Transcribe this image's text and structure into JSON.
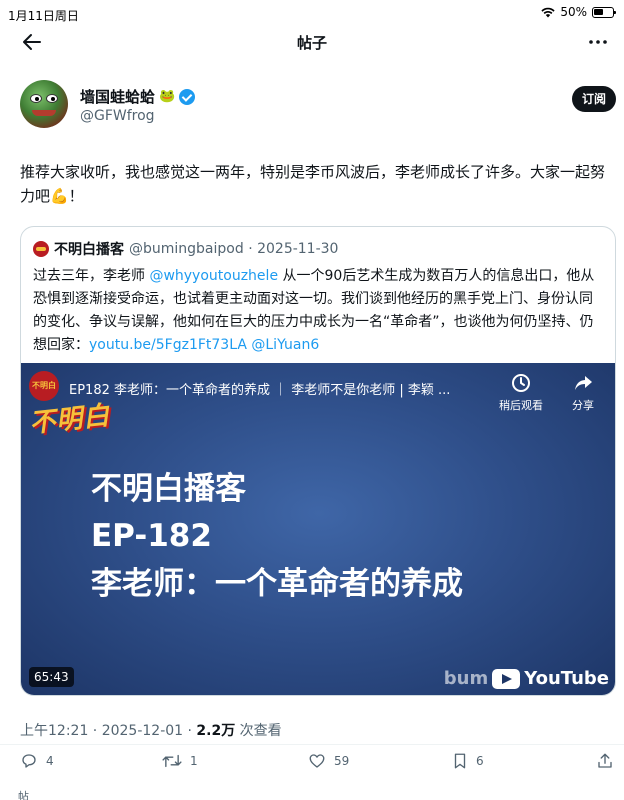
{
  "status_bar": {
    "time": "1月11日周日",
    "battery_percent": "50%"
  },
  "nav": {
    "title": "帖子",
    "icons": [
      "back-arrow-icon",
      "more-icon"
    ]
  },
  "author": {
    "display_name": "墙国蛙蛤蛤",
    "name_emoji": "🐸",
    "handle": "@GFWfrog",
    "subscribe_label": "订阅",
    "verified": true
  },
  "post": {
    "text": "推荐大家收听，我也感觉这一两年，特别是李币风波后，李老师成长了许多。大家一起努力吧💪！",
    "timestamp": "上午12:21 · 2025-12-01 · ",
    "views_count": "2.2万",
    "views_label": " 次查看"
  },
  "quoted": {
    "name": "不明白播客",
    "meta": "@bumingbaipod · 2025-11-30",
    "body_part1": "过去三年，李老师 ",
    "mention1": "@whyyoutouzhele",
    "body_part2": " 从一个90后艺术生成为数百万人的信息出口，他从恐惧到逐渐接受命运，也试着更主动面对这一切。我们谈到他经历的黑手党上门、身份认同的变化、争议与误解，他如何在巨大的压力中成长为一名“革命者”，也谈他为何仍坚持、仍想回家：",
    "link": "youtu.be/5Fgz1Ft73LA",
    "mention2": "@LiYuan6"
  },
  "video": {
    "channel_logo_text": "不明白",
    "title": "EP182 李老师：一个革命者的养成 ｜ 李老师不是你老师 | 李颖 ...",
    "watermark": "不明白",
    "watch_later_label": "稍后观看",
    "share_label": "分享",
    "line1": "不明白播客",
    "line2": "EP-182",
    "line3": "李老师：一个革命者的养成",
    "duration": "65:43",
    "brand_prefix": "bum",
    "youtube_label": "YouTube"
  },
  "actions": {
    "replies": "4",
    "reposts": "1",
    "likes": "59",
    "bookmarks": "6"
  },
  "bottom_peek": "帖"
}
